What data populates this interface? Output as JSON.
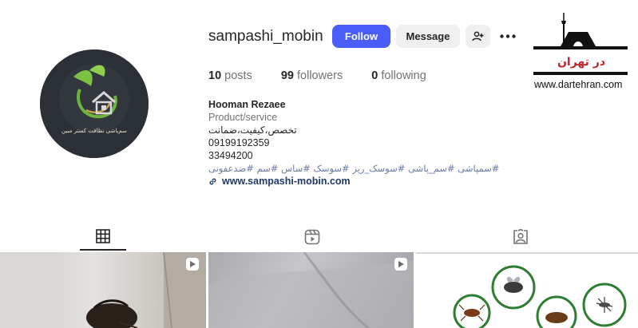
{
  "profile": {
    "username": "sampashi_mobin",
    "follow_label": "Follow",
    "message_label": "Message",
    "stats": {
      "posts_count": "10",
      "posts_label": "posts",
      "followers_count": "99",
      "followers_label": "followers",
      "following_count": "0",
      "following_label": "following"
    },
    "bio": {
      "name": "Hooman Rezaee",
      "category": "Product/service",
      "line1": "تخصص،کیفیت،ضمانت",
      "phone1": "09199192359",
      "phone2": "33494200",
      "hashtags": "#سمپاشی #سم_پاشی #سوسک_ریز #سوسک #ساس #سم #ضدعفونی",
      "link": "www.sampashi-mobin.com"
    },
    "avatar_caption": "سم‌پاشی نظافت کستر مبین"
  },
  "watermark": {
    "text_fa": "در تهران",
    "site": "www.dartehran.com"
  },
  "tabs": [
    {
      "name": "posts",
      "icon": "grid-icon",
      "active": true
    },
    {
      "name": "reels",
      "icon": "reels-icon",
      "active": false
    },
    {
      "name": "tagged",
      "icon": "tagged-icon",
      "active": false
    }
  ],
  "icons": {
    "add_user": "add-user-icon",
    "more": "more-icon",
    "link": "link-icon",
    "reel_badge": "reel-icon"
  },
  "colors": {
    "follow_button": "#4a5df9",
    "secondary_button": "#efefef",
    "hashtags": "#6a7ca9",
    "link": "#1d3a6b"
  }
}
